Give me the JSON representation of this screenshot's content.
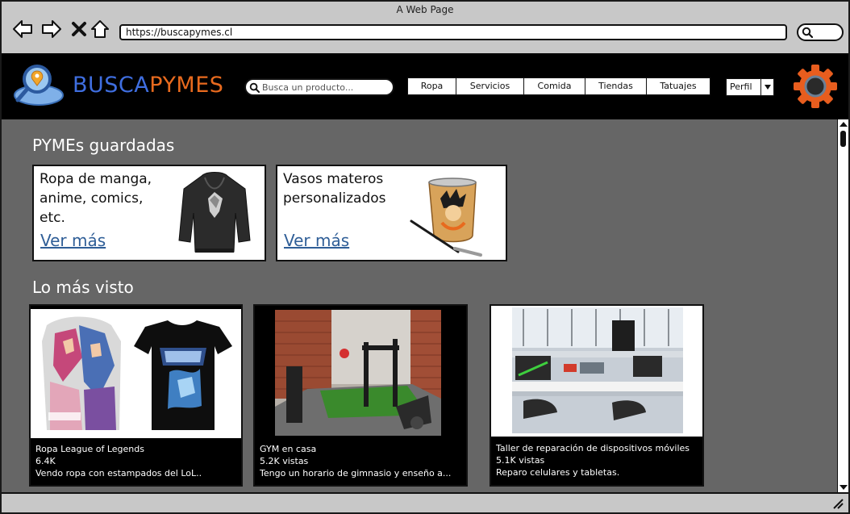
{
  "window": {
    "title": "A Web Page"
  },
  "browser": {
    "url": "https://buscapymes.cl",
    "icons": [
      "back-arrow-icon",
      "forward-arrow-icon",
      "close-x-icon",
      "home-icon",
      "search-icon"
    ]
  },
  "header": {
    "brand_part1": "BUSCA",
    "brand_part2": "PYMES",
    "search_placeholder": "Busca un producto...",
    "categories": [
      "Ropa",
      "Servicios",
      "Comida",
      "Tiendas",
      "Tatuajes"
    ],
    "profile_label": "Perfil",
    "colors": {
      "brand_blue": "#3f6ee0",
      "brand_orange": "#e86a1e",
      "gear_orange": "#e85d1e"
    }
  },
  "saved": {
    "title": "PYMEs guardadas",
    "cards": [
      {
        "text": "Ropa de manga, anime, comics, etc.",
        "link": "Ver más",
        "image": "black-hoodie-image"
      },
      {
        "text": "Vasos materos personalizados",
        "link": "Ver más",
        "image": "mate-cup-image"
      }
    ]
  },
  "popular": {
    "title": "Lo más visto",
    "cards": [
      {
        "title": "Ropa League of Legends",
        "views": "6.4K",
        "desc": "Vendo ropa con estampados del LoL..",
        "image": "league-shirts-image"
      },
      {
        "title": "GYM en casa",
        "views": "5.2K vistas",
        "desc": "Tengo un horario de gimnasio y enseño a...",
        "image": "home-gym-image"
      },
      {
        "title": "Taller de reparación de dispositivos móviles",
        "views": "5.1K vistas",
        "desc": "Reparo celulares y tabletas.",
        "image": "repair-workshop-image"
      }
    ]
  }
}
